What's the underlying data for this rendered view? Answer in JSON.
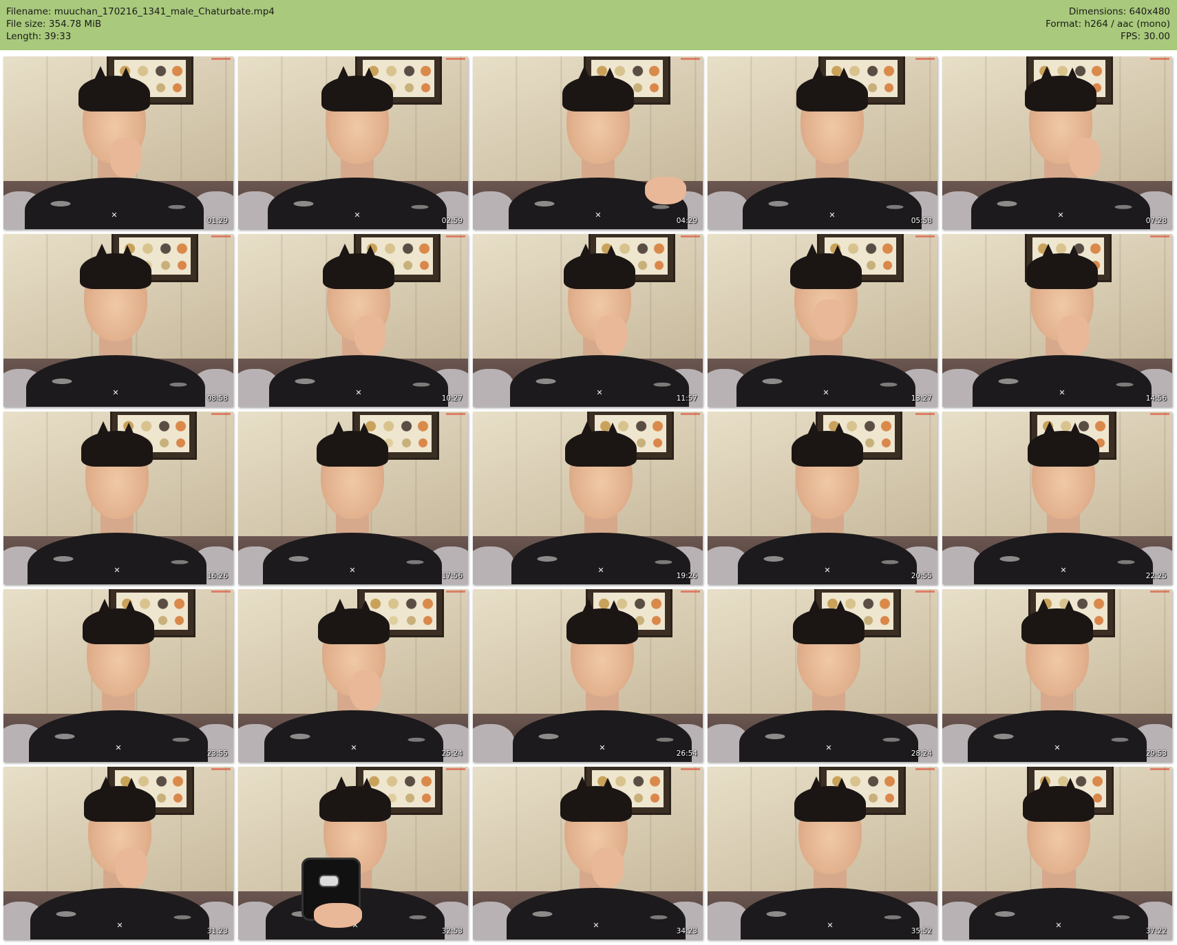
{
  "header": {
    "background_color": "#a9c97c",
    "filename": "Filename: muuchan_170216_1341_male_Chaturbate.mp4",
    "file_size": "File size: 354.78 MiB",
    "length": "Length: 39:33",
    "dimensions": "Dimensions: 640x480",
    "format": "Format: h264 / aac (mono)",
    "fps": "FPS: 30.00"
  },
  "thumbnails": [
    {
      "timestamp": "01:29",
      "hand": "chin"
    },
    {
      "timestamp": "02:59",
      "hand": "none"
    },
    {
      "timestamp": "04:29",
      "hand": "wave"
    },
    {
      "timestamp": "05:58",
      "hand": "none"
    },
    {
      "timestamp": "07:28",
      "hand": "cheek"
    },
    {
      "timestamp": "08:58",
      "hand": "none"
    },
    {
      "timestamp": "10:27",
      "hand": "chin"
    },
    {
      "timestamp": "11:57",
      "hand": "chin"
    },
    {
      "timestamp": "13:27",
      "hand": "mouth"
    },
    {
      "timestamp": "14:56",
      "hand": "chin"
    },
    {
      "timestamp": "16:26",
      "hand": "none"
    },
    {
      "timestamp": "17:56",
      "hand": "none"
    },
    {
      "timestamp": "19:26",
      "hand": "none"
    },
    {
      "timestamp": "20:55",
      "hand": "none"
    },
    {
      "timestamp": "22:25",
      "hand": "none"
    },
    {
      "timestamp": "23:55",
      "hand": "none"
    },
    {
      "timestamp": "25:24",
      "hand": "chin"
    },
    {
      "timestamp": "26:54",
      "hand": "none"
    },
    {
      "timestamp": "28:24",
      "hand": "none"
    },
    {
      "timestamp": "29:53",
      "hand": "none"
    },
    {
      "timestamp": "31:23",
      "hand": "chin"
    },
    {
      "timestamp": "32:53",
      "hand": "phone"
    },
    {
      "timestamp": "34:23",
      "hand": "chin"
    },
    {
      "timestamp": "35:52",
      "hand": "none"
    },
    {
      "timestamp": "37:22",
      "hand": "none"
    }
  ]
}
